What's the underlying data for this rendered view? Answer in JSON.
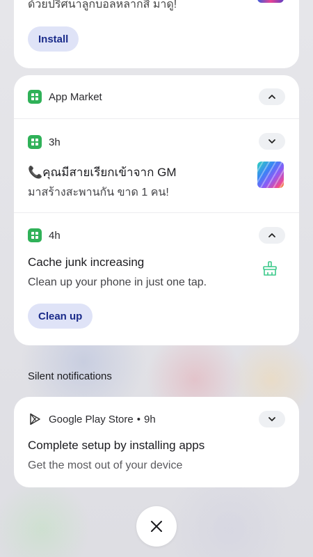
{
  "top_card": {
    "partial_text": "ด้วยปริศนาลูกบอลหลากสี มาดู!",
    "install_label": "Install"
  },
  "group": {
    "app_name": "App Market",
    "notifications": [
      {
        "time": "3h",
        "title": "📞คุณมีสายเรียกเข้าจาก GM",
        "body": "มาสร้างสะพานกัน ขาด 1 คน!"
      },
      {
        "time": "4h",
        "title": "Cache junk increasing",
        "body": "Clean up your phone in just one tap.",
        "action_label": "Clean up"
      }
    ]
  },
  "silent_section": {
    "label": "Silent notifications"
  },
  "play_card": {
    "app_name": "Google Play Store",
    "separator": "•",
    "time": "9h",
    "title": "Complete setup by installing apps",
    "body": "Get the most out of your device"
  },
  "icons": {
    "app_market": "app-market-icon",
    "play": "play-store-icon",
    "broom": "broom-icon",
    "close": "close-icon"
  },
  "colors": {
    "accent_button_bg": "#dfe3f7",
    "accent_button_text": "#1a2b8a",
    "app_market_green": "#2fb158",
    "broom_green": "#3cc98a"
  }
}
